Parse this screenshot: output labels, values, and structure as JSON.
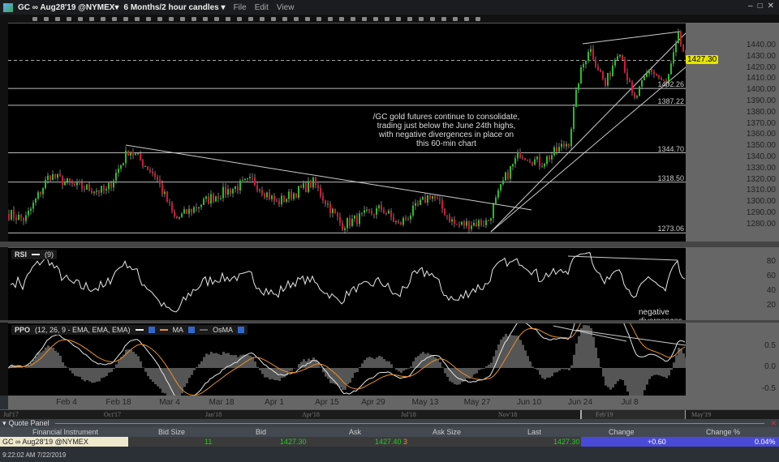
{
  "title": {
    "symbol": "GC ∞ Aug28'19 @NYMEX",
    "symbol_caret": "▾",
    "timeframe": "6 Months/2 hour candles",
    "timeframe_caret": "▾",
    "menus": [
      "File",
      "Edit",
      "View"
    ]
  },
  "window_controls": [
    "–",
    "□",
    "✕"
  ],
  "price_panel": {
    "annotation": [
      "/GC gold futures continue to consolidate,",
      "trading just below the June 24th highs,",
      "with negative divergences in place on",
      "this 60-min chart"
    ],
    "axis_ticks": [
      "1440.00",
      "1430.00",
      "1420.00",
      "1410.00",
      "1400.00",
      "1390.00",
      "1380.00",
      "1370.00",
      "1360.00",
      "1350.00",
      "1340.00",
      "1330.00",
      "1320.00",
      "1310.00",
      "1300.00",
      "1290.00",
      "1280.00"
    ],
    "last_price": "1427.30",
    "levels": [
      "1402.26",
      "1387.22",
      "1344.70",
      "1318.50",
      "1273.06"
    ],
    "colors": {
      "up": "#22c322",
      "down": "#e0103a",
      "last_badge": "#e6e600"
    }
  },
  "rsi_panel": {
    "name": "RSI",
    "params": "(9)",
    "ticks": [
      "80",
      "60",
      "40",
      "20"
    ],
    "annotation": "negative divergences"
  },
  "ppo_panel": {
    "name": "PPO",
    "params": "(12, 26, 9 - EMA, EMA, EMA)",
    "ma_label": "MA",
    "osma_label": "OsMA",
    "ticks": [
      "0.5",
      "0.0",
      "-0.5"
    ],
    "colors": {
      "ppo": "#e8e8e8",
      "ma": "#e8902a",
      "osma": "#555555"
    }
  },
  "date_axis": [
    "Feb 4",
    "Feb 18",
    "Mar 4",
    "Mar 18",
    "Apr 1",
    "Apr 15",
    "Apr 29",
    "May 13",
    "May 27",
    "Jun 10",
    "Jun 24",
    "Jul 8"
  ],
  "navigator": [
    "Jul'17",
    "Oct'17",
    "Jan'18",
    "Apr'18",
    "Jul'18",
    "Nov'18",
    "Feb'19",
    "May'19"
  ],
  "quote_panel": {
    "title": "Quote Panel",
    "columns": [
      "Financial Instrument",
      "Bid Size",
      "Bid",
      "Ask",
      "Ask Size",
      "Last",
      "Change",
      "Change %"
    ],
    "row": {
      "instrument": "GC ∞ Aug28'19 @NYMEX",
      "bid_size": "11",
      "bid": "1427.30",
      "ask": "1427.40",
      "ask_size": "3",
      "last": "1427.30",
      "change": "+0.60",
      "change_pct": "0.04%"
    }
  },
  "status": {
    "timestamp": "9:22:02 AM 7/22/2019"
  }
}
